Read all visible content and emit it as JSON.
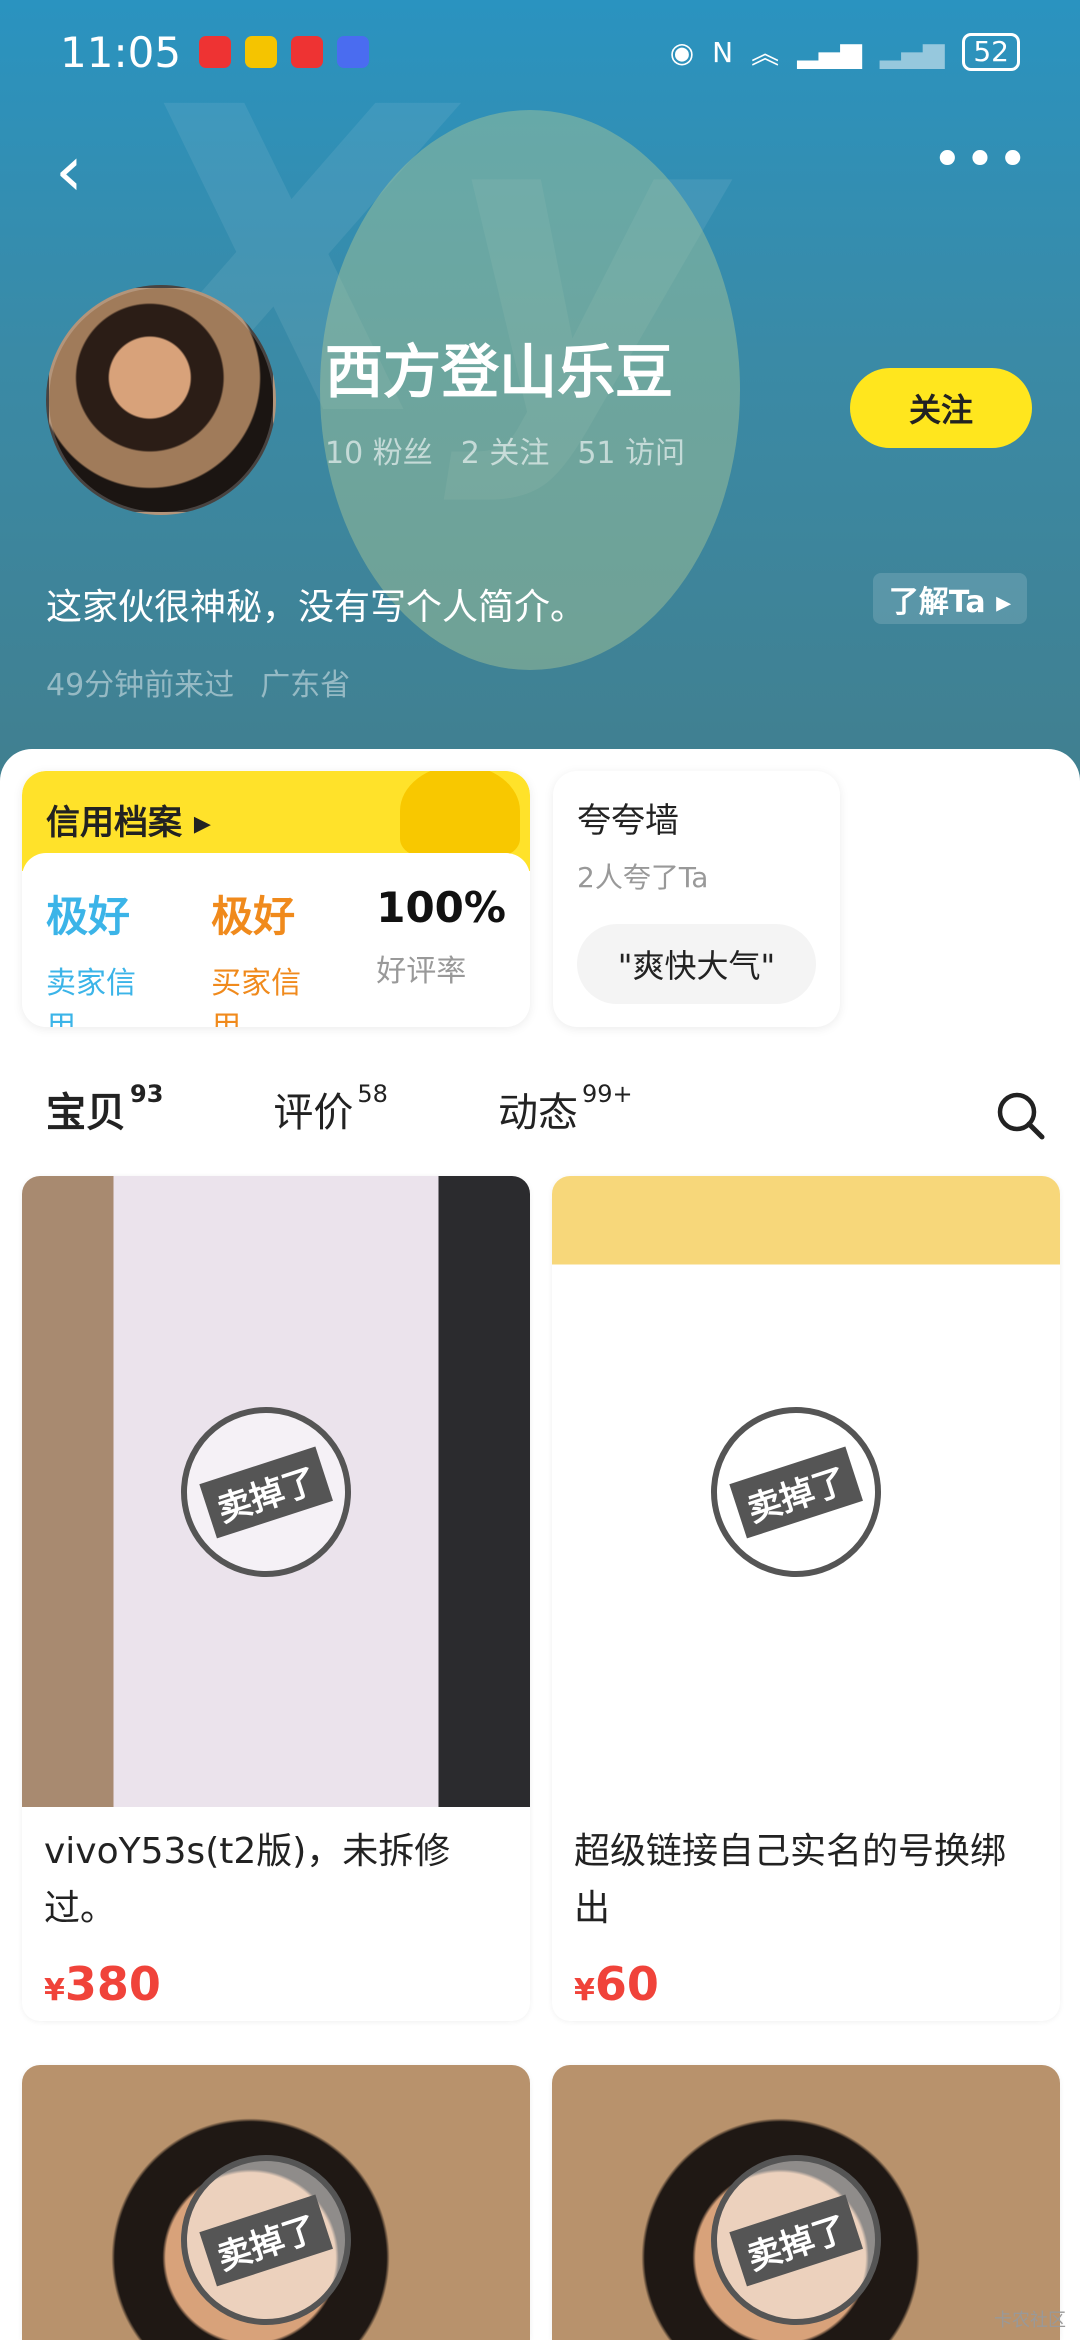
{
  "status_bar": {
    "time": "11:05",
    "battery": "52"
  },
  "profile": {
    "name": "西方登山乐豆",
    "stats": [
      "10 粉丝",
      "2 关注",
      "51 访问"
    ],
    "follow_label": "关注",
    "bio": "这家伙很神秘，没有写个人简介。",
    "know_label": "了解Ta ▸",
    "last_seen": "49分钟前来过",
    "location": "广东省"
  },
  "credit": {
    "title": "信用档案 ▸",
    "metrics": [
      {
        "value": "极好",
        "label": "卖家信用",
        "color": "#3bb4e8"
      },
      {
        "value": "极好",
        "label": "买家信用",
        "color": "#f08a1c"
      },
      {
        "value": "100%",
        "label": "好评率",
        "color": "#111"
      }
    ]
  },
  "praise": {
    "title": "夸夸墙",
    "subtitle": "2人夸了Ta",
    "tag": "\"爽快大气\""
  },
  "tabs": [
    {
      "label": "宝贝",
      "count": "93"
    },
    {
      "label": "评价",
      "count": "58"
    },
    {
      "label": "动态",
      "count": "99+"
    }
  ],
  "products": [
    {
      "title": "vivoY53s(t2版)，未拆修过。",
      "currency": "¥",
      "price": "380",
      "stamp": "卖掉了"
    },
    {
      "title": "超级链接自己实名的号换绑出",
      "currency": "¥",
      "price": "60",
      "stamp": "卖掉了"
    },
    {
      "stamp": "卖掉了"
    },
    {
      "stamp": "卖掉了"
    }
  ],
  "watermark": "卡农社区"
}
